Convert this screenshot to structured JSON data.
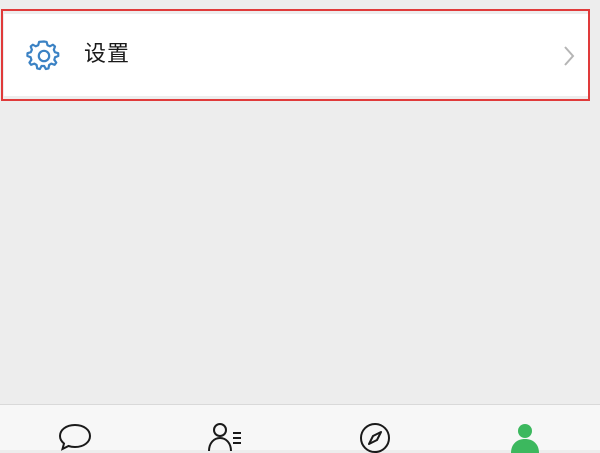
{
  "settings": {
    "label": "设置",
    "icon": "gear-icon",
    "icon_color": "#3b82c4",
    "chevron_icon": "chevron-right-icon"
  },
  "highlight": {
    "color": "#e03a3a"
  },
  "bottom_nav": {
    "items": [
      {
        "icon": "chat-icon",
        "active": false
      },
      {
        "icon": "contacts-icon",
        "active": false
      },
      {
        "icon": "discover-compass-icon",
        "active": false
      },
      {
        "icon": "me-profile-icon",
        "active": true,
        "color": "#3cb85e"
      }
    ]
  }
}
